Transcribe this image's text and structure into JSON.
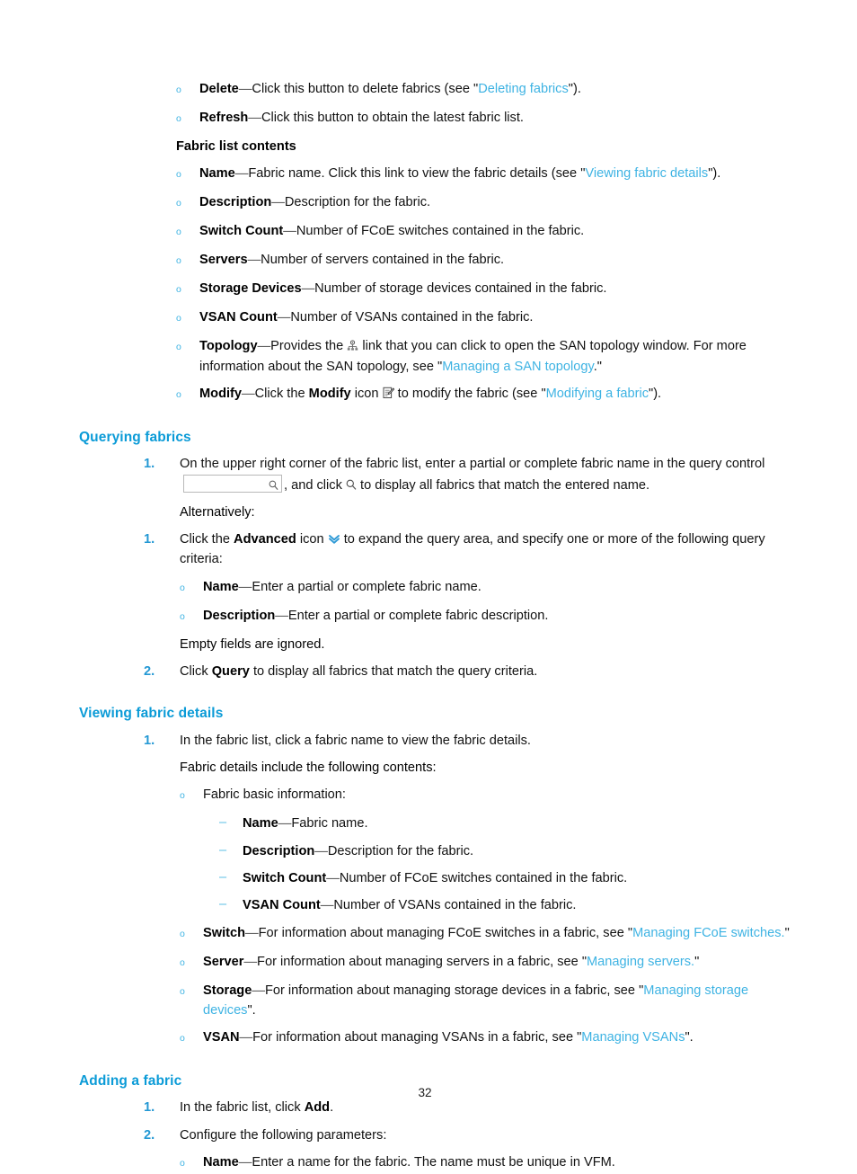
{
  "page": {
    "number": "32"
  },
  "top_list": {
    "items": [
      {
        "marker": "o",
        "term": "Delete",
        "sep": "—",
        "text_before": "Click this button to delete fabrics (see \"",
        "link": "Deleting fabrics",
        "text_after": "\")."
      },
      {
        "marker": "o",
        "term": "Refresh",
        "sep": "—",
        "text_before": "Click this button to obtain the latest fabric list.",
        "link": "",
        "text_after": ""
      }
    ]
  },
  "fabric_list_contents": {
    "heading": "Fabric list contents",
    "items": [
      {
        "term": "Name",
        "sep": "—",
        "text_before": "Fabric name. Click this link to view the fabric details (see \"",
        "link": "Viewing fabric details",
        "text_after": "\")."
      },
      {
        "term": "Description",
        "sep": "—",
        "text_before": "Description for the fabric.",
        "link": "",
        "text_after": ""
      },
      {
        "term": "Switch Count",
        "sep": "—",
        "text_before": "Number of FCoE switches contained in the fabric.",
        "link": "",
        "text_after": ""
      },
      {
        "term": "Servers",
        "sep": "—",
        "text_before": "Number of servers contained in the fabric.",
        "link": "",
        "text_after": ""
      },
      {
        "term": "Storage Devices",
        "sep": "—",
        "text_before": "Number of storage devices contained in the fabric.",
        "link": "",
        "text_after": ""
      },
      {
        "term": "VSAN Count",
        "sep": "—",
        "text_before": "Number of VSANs contained in the fabric.",
        "link": "",
        "text_after": ""
      }
    ],
    "topology": {
      "term": "Topology",
      "sep": "—",
      "text_before": "Provides the",
      "icon": "san-topology-icon",
      "text_mid": "link that you can click to open the SAN topology window. For more information about the SAN topology, see \"",
      "link": "Managing a SAN topology",
      "text_after": ".\""
    },
    "modify": {
      "term": "Modify",
      "sep": "—",
      "text_before": "Click the",
      "term2": "Modify",
      "text_mid1": "icon",
      "icon": "modify-pencil-icon",
      "text_mid2": "to modify the fabric (see \"",
      "link": "Modifying a fabric",
      "text_after": "\")."
    }
  },
  "querying_fabrics": {
    "heading": "Querying fabrics",
    "step1": {
      "marker": "1.",
      "text_before": "On the upper right corner of the fabric list, enter a partial or complete fabric name in the query control",
      "input_value": "",
      "input_placeholder": "",
      "text_mid": ", and click",
      "text_after": "to display all fabrics that match the entered name."
    },
    "alternatively": "Alternatively:",
    "alt_step1": {
      "marker": "1.",
      "text_before": "Click the",
      "term": "Advanced",
      "text_mid": "icon",
      "icon": "advanced-chevron-icon",
      "text_after": "to expand the query area, and specify one or more of the following query criteria:"
    },
    "criteria": [
      {
        "term": "Name",
        "sep": "—",
        "text": "Enter a partial or complete fabric name."
      },
      {
        "term": "Description",
        "sep": "—",
        "text": "Enter a partial or complete fabric description."
      }
    ],
    "note": "Empty fields are ignored.",
    "step2": {
      "marker": "2.",
      "text_before": "Click",
      "term": "Query",
      "text_after": "to display all fabrics that match the query criteria."
    }
  },
  "viewing_fabric_details": {
    "heading": "Viewing fabric details",
    "step1": {
      "marker": "1.",
      "text": "In the fabric list, click a fabric name to view the fabric details."
    },
    "intro": "Fabric details include the following contents:",
    "basic_info_label": "Fabric basic information:",
    "basic_info": [
      {
        "term": "Name",
        "sep": "—",
        "text": "Fabric name."
      },
      {
        "term": "Description",
        "sep": "—",
        "text": "Description for the fabric."
      },
      {
        "term": "Switch Count",
        "sep": "—",
        "text": "Number of FCoE switches contained in the fabric."
      },
      {
        "term": "VSAN Count",
        "sep": "—",
        "text": "Number of VSANs contained in the fabric."
      }
    ],
    "resources": [
      {
        "term": "Switch",
        "sep": "—",
        "text_before": "For information about managing FCoE switches in a fabric, see \"",
        "link": "Managing FCoE switches.",
        "text_after": "\""
      },
      {
        "term": "Server",
        "sep": "—",
        "text_before": "For information about managing servers in a fabric, see \"",
        "link": "Managing servers.",
        "text_after": "\""
      },
      {
        "term": "Storage",
        "sep": "—",
        "text_before": "For information about managing storage devices in a fabric, see \"",
        "link": "Managing storage devices",
        "text_after": "\"."
      },
      {
        "term": "VSAN",
        "sep": "—",
        "text_before": "For information about managing VSANs in a fabric, see \"",
        "link": "Managing VSANs",
        "text_after": "\"."
      }
    ]
  },
  "adding_a_fabric": {
    "heading": "Adding a fabric",
    "step1": {
      "marker": "1.",
      "text_before": "In the fabric list, click",
      "term": "Add",
      "text_after": "."
    },
    "step2": {
      "marker": "2.",
      "text": "Configure the following parameters:"
    },
    "params": [
      {
        "term": "Name",
        "sep": "—",
        "text": "Enter a name for the fabric. The name must be unique in VFM."
      }
    ]
  },
  "colors": {
    "heading": "#0b9bd7",
    "link": "#3eb3e3",
    "marker": "#2398d4",
    "bullet": "#3eb3e3"
  }
}
